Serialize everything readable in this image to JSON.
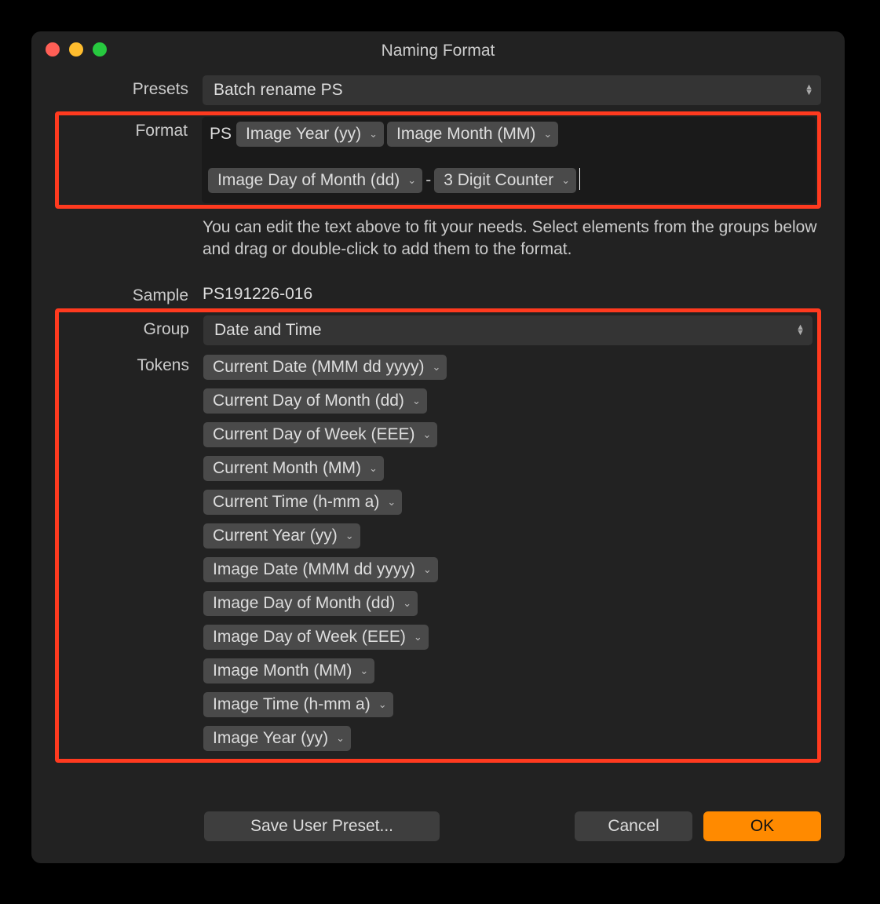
{
  "window": {
    "title": "Naming Format"
  },
  "labels": {
    "presets": "Presets",
    "format": "Format",
    "sample": "Sample",
    "group": "Group",
    "tokens": "Tokens"
  },
  "presets": {
    "selected": "Batch rename PS"
  },
  "format": {
    "prefix": "PS",
    "tokens_row1": [
      "Image Year (yy)",
      "Image Month (MM)"
    ],
    "tokens_row2": [
      "Image Day of Month (dd)",
      "-",
      "3 Digit Counter"
    ]
  },
  "help_text": "You can edit the text above to fit your needs. Select elements from the groups below and drag or double-click to add them to the format.",
  "sample_value": "PS191226-016",
  "group": {
    "selected": "Date and Time"
  },
  "tokens": [
    "Current Date (MMM dd yyyy)",
    "Current Day of Month (dd)",
    "Current Day of Week (EEE)",
    "Current Month (MM)",
    "Current Time (h-mm a)",
    "Current Year (yy)",
    "Image Date (MMM dd yyyy)",
    "Image Day of Month (dd)",
    "Image Day of Week (EEE)",
    "Image Month (MM)",
    "Image Time (h-mm a)",
    "Image Year (yy)"
  ],
  "buttons": {
    "save_preset": "Save User Preset...",
    "cancel": "Cancel",
    "ok": "OK"
  }
}
